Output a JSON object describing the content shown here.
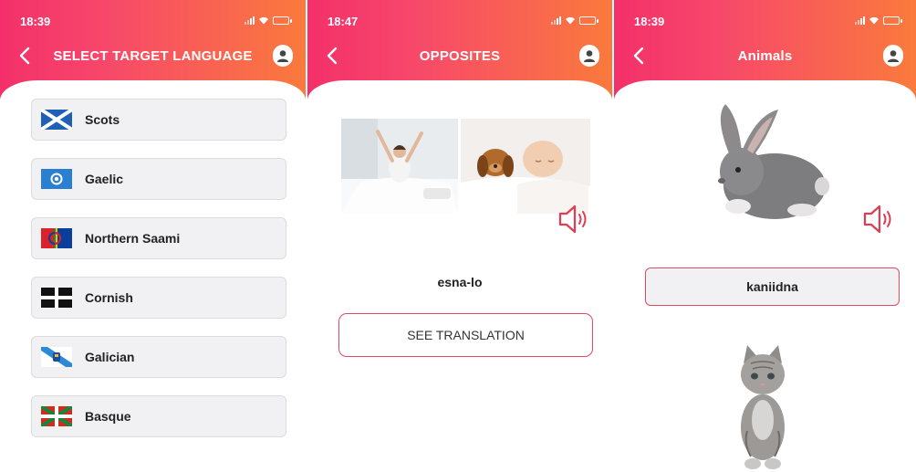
{
  "screens": [
    {
      "time": "18:39",
      "title": "SELECT TARGET LANGUAGE",
      "languages": [
        {
          "label": "Scots",
          "flag": "scotland-flag-icon"
        },
        {
          "label": "Gaelic",
          "flag": "gaelic-flag-icon"
        },
        {
          "label": "Northern Saami",
          "flag": "saami-flag-icon"
        },
        {
          "label": "Cornish",
          "flag": "cornwall-flag-icon"
        },
        {
          "label": "Galician",
          "flag": "galicia-flag-icon"
        },
        {
          "label": "Basque",
          "flag": "basque-flag-icon"
        }
      ]
    },
    {
      "time": "18:47",
      "title": "OPPOSITES",
      "word": "esna-lo",
      "button": "SEE TRANSLATION",
      "images": [
        "woman-waking-photo",
        "sleeping-baby-puppy-photo"
      ]
    },
    {
      "time": "18:39",
      "title": "Animals",
      "word": "kaniidna",
      "images": [
        "rabbit-photo",
        "kitten-photo"
      ]
    }
  ],
  "icons": {
    "back": "chevron-left-icon",
    "profile": "profile-icon",
    "speaker": "speaker-icon"
  },
  "colors": {
    "header_start": "#f4306a",
    "header_end": "#fa7a3c",
    "accent": "#e04a60",
    "item_bg": "#f1f1f3"
  }
}
